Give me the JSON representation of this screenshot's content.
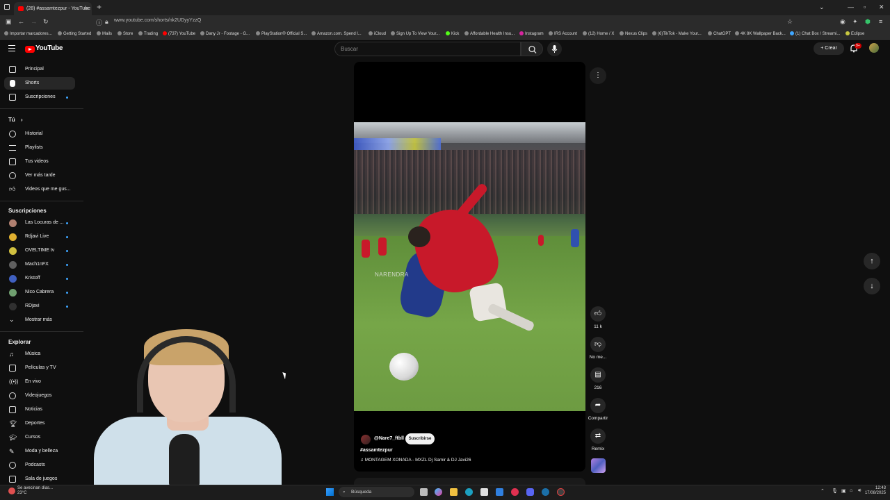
{
  "browser": {
    "tab_title": "(28) #assamtezpur - YouTube",
    "url": "www.youtube.com/shorts/nk2UDyyYzzQ",
    "bookmarks": [
      "Importar marcadores...",
      "Getting Started",
      "Mails",
      "Store",
      "Trading",
      "(737) YouTube",
      "Dany Jr - Footage - G...",
      "PlayStation® Official S...",
      "Amazon.com. Spend l...",
      "iCloud",
      "Sign Up To View Your...",
      "Kick",
      "Affordable Health Insu...",
      "Instagram",
      "IRS Account",
      "(12) Home / X",
      "Nexus Clips",
      "(6)TikTok - Make Your...",
      "ChatGPT",
      "4K 8K Wallpaper Back...",
      "(1) Chat Box / Streami...",
      "Eclipse"
    ]
  },
  "header": {
    "logo": "YouTube",
    "search_placeholder": "Buscar",
    "create_label": "Crear",
    "notif_badge": "9+"
  },
  "sidebar": {
    "main": [
      "Principal",
      "Shorts",
      "Suscripciones"
    ],
    "you_heading": "Tú",
    "you": [
      "Historial",
      "Playlists",
      "Tus videos",
      "Ver más tarde",
      "Videos que me gus..."
    ],
    "subs_heading": "Suscripciones",
    "subs": [
      "Las Locuras de ...",
      "Rdjavi Live",
      "OVELTIME tv",
      "Mach1nFX",
      "Kristoff",
      "Nico Cabrera",
      "RDjavi"
    ],
    "show_more": "Mostrar más",
    "explore_heading": "Explorar",
    "explore": [
      "Música",
      "Películas y TV",
      "En vivo",
      "Videojuegos",
      "Noticias",
      "Deportes",
      "Cursos",
      "Moda y belleza",
      "Podcasts",
      "Sala de juegos"
    ]
  },
  "video": {
    "watermark": "NARENDRA",
    "channel": "@Nare7_ftbll",
    "subscribe_label": "Suscribirse",
    "hashtag": "#assamtezpur",
    "music": "MONTAGEM XONADA - MXZL Dj Samir & DJ Javi26"
  },
  "actions": {
    "likes": "11 k",
    "dislike_label": "No me...",
    "comments": "216",
    "share_label": "Compartir",
    "remix_label": "Remix"
  },
  "taskbar": {
    "weather_line1": "Se avecinan días...",
    "weather_line2": "23°C",
    "search_label": "Búsqueda",
    "time": "12:43",
    "date": "17/08/2025"
  }
}
